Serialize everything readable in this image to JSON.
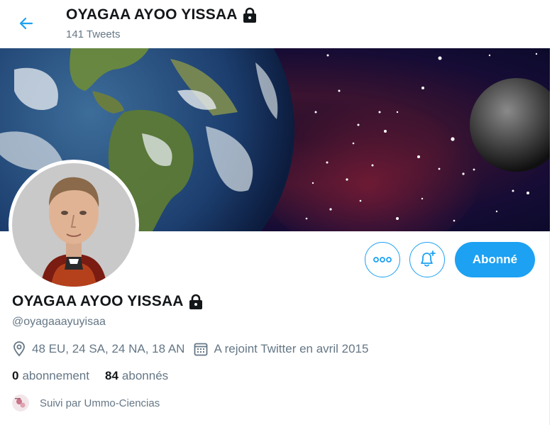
{
  "header": {
    "title": "OYAGAA AYOO YISSAA",
    "tweets_count": "141 Tweets"
  },
  "profile": {
    "name": "OYAGAA AYOO YISSAA",
    "handle": "@oyagaaayuyisaa",
    "location": "48 EU, 24 SA, 24 NA, 18 AN",
    "joined": "A rejoint Twitter en avril 2015",
    "following_count": "0",
    "following_label": "abonnement",
    "followers_count": "84",
    "followers_label": "abonnés",
    "followed_by": "Suivi par Ummo-Ciencias"
  },
  "actions": {
    "follow_label": "Abonné"
  },
  "icons": {
    "back": "arrow-left-icon",
    "lock": "lock-icon",
    "more": "more-dots-icon",
    "bell": "bell-plus-icon",
    "location": "location-pin-icon",
    "calendar": "calendar-icon"
  },
  "colors": {
    "accent": "#1da1f2",
    "secondary_text": "#657786",
    "primary_text": "#14171a"
  }
}
